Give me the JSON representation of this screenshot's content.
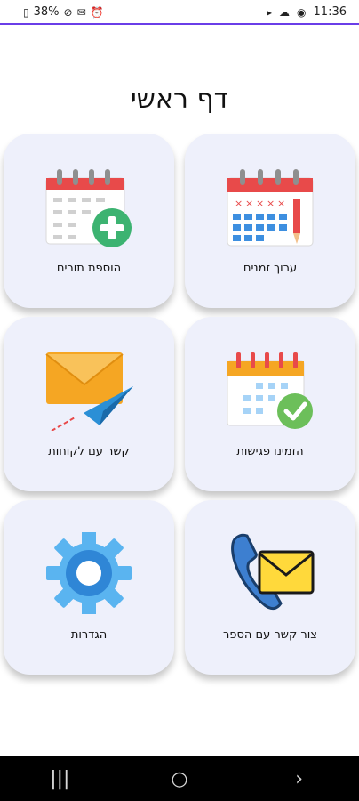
{
  "status_bar": {
    "battery": "38%",
    "time": "11:36",
    "left_icons": [
      "battery-icon",
      "mute-icon",
      "mail-icon",
      "alarm-icon"
    ],
    "right_icons": [
      "cast-icon",
      "cloud-icon",
      "app-icon",
      "notification-icon"
    ]
  },
  "page_title": "דף ראשי",
  "tiles": [
    {
      "label": "ערוך זמנים"
    },
    {
      "label": "הוספת תורים"
    },
    {
      "label": "הזמינו פגישות"
    },
    {
      "label": "קשר עם לקוחות"
    },
    {
      "label": "צור קשר עם הספר"
    },
    {
      "label": "הגדרות"
    }
  ],
  "nav": {
    "recents": "|||",
    "home": "○",
    "back": "›"
  },
  "colors": {
    "tile_bg": "#eef0fb",
    "accent_purple": "#6a3de8",
    "calendar_red": "#e84a4a",
    "plus_green": "#3cb371",
    "gear_blue": "#5ab4f0"
  }
}
